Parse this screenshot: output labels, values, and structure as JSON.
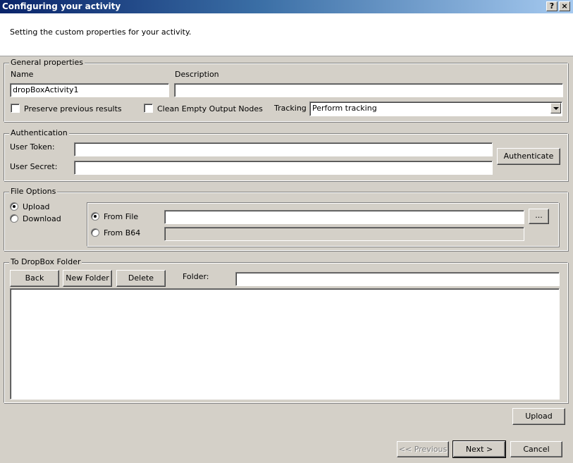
{
  "window": {
    "title": "Configuring your activity",
    "help_label": "?",
    "close_label": "×",
    "subtitle": "Setting the custom properties for your activity."
  },
  "general": {
    "legend": "General properties",
    "name_label": "Name",
    "name_value": "dropBoxActivity1",
    "description_label": "Description",
    "description_value": "",
    "preserve_label": "Preserve previous results",
    "preserve_checked": false,
    "clean_label": "Clean Empty Output Nodes",
    "clean_checked": false,
    "tracking_label": "Tracking",
    "tracking_value": "Perform tracking"
  },
  "auth": {
    "legend": "Authentication",
    "token_label": "User Token:",
    "token_value": "",
    "secret_label": "User Secret:",
    "secret_value": "",
    "authenticate_label": "Authenticate"
  },
  "file_options": {
    "legend": "File Options",
    "upload_label": "Upload",
    "upload_selected": true,
    "download_label": "Download",
    "from_file_label": "From File",
    "from_file_selected": true,
    "from_file_value": "",
    "browse_label": "...",
    "from_b64_label": "From B64",
    "from_b64_value": ""
  },
  "dropbox": {
    "legend": "To DropBox Folder",
    "back_label": "Back",
    "new_folder_label": "New Folder",
    "delete_label": "Delete",
    "folder_label": "Folder:",
    "folder_value": ""
  },
  "footer": {
    "upload_label": "Upload",
    "previous_label": "<< Previous",
    "next_label": "Next >",
    "cancel_label": "Cancel"
  }
}
